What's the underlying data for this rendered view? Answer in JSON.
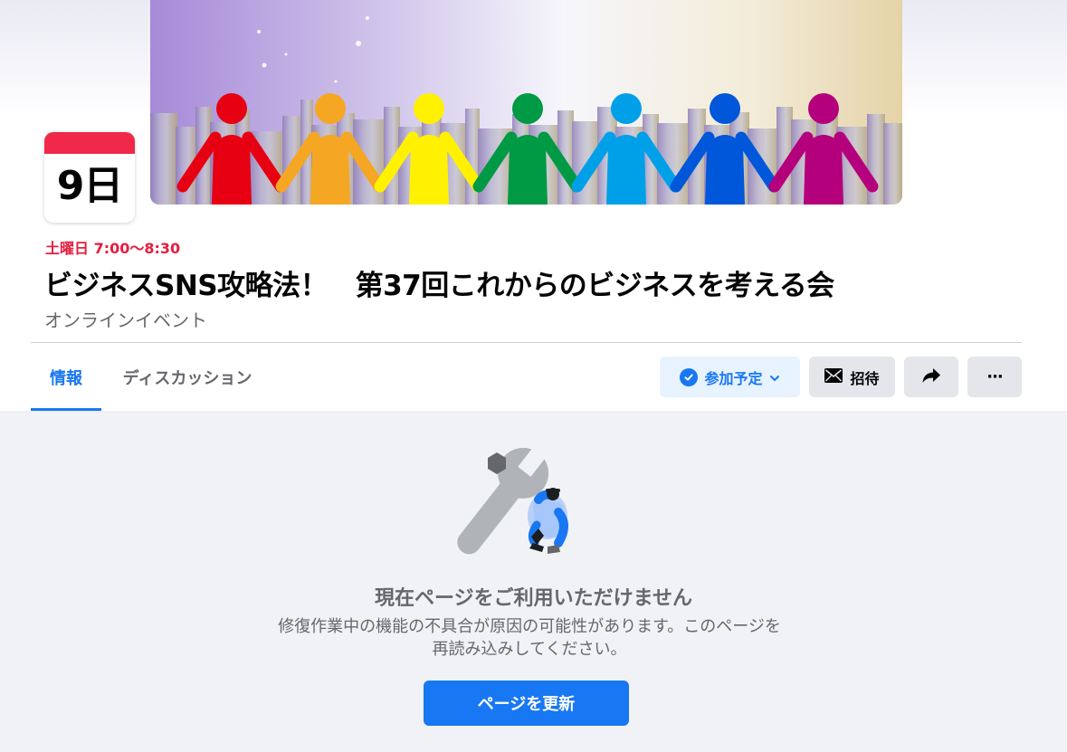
{
  "event": {
    "date_day": "9日",
    "time": "土曜日 7:00〜8:30",
    "title": "ビジネスSNS攻略法！　第37回これからのビジネスを考える会",
    "location": "オンラインイベント"
  },
  "cover": {
    "icon": "cover-photo",
    "figure_colors": [
      "#e60012",
      "#f5a623",
      "#fff100",
      "#009944",
      "#00a0e9",
      "#0057d9",
      "#b4007c"
    ]
  },
  "tabs": [
    {
      "label": "情報",
      "active": true
    },
    {
      "label": "ディスカッション",
      "active": false
    }
  ],
  "actions": {
    "going_label": "参加予定",
    "going_icon": "check-circle-icon",
    "invite_label": "招待",
    "invite_icon": "envelope-icon",
    "share_icon": "share-arrow-icon",
    "more_icon": "ellipsis-icon",
    "more_glyph": "···"
  },
  "error": {
    "illustration": "wrench-worker-illustration",
    "title": "現在ページをご利用いただけません",
    "body": "修復作業中の機能の不具合が原因の可能性があります。このページを再読み込みしてください。",
    "reload_label": "ページを更新"
  },
  "colors": {
    "accent": "#1877f2",
    "event_time": "#e41e3f",
    "calendar_top": "#f02849",
    "secondary_text": "#65676b",
    "page_bg": "#f0f2f5"
  }
}
